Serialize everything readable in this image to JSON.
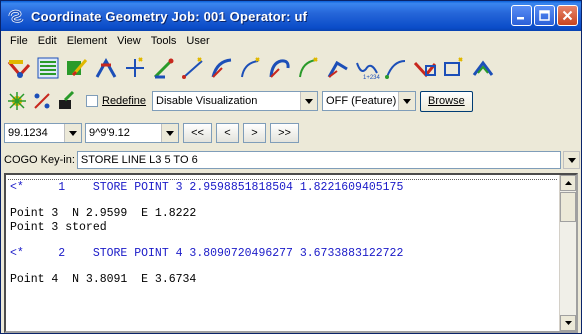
{
  "window": {
    "title": "Coordinate Geometry   Job: 001   Operator: uf"
  },
  "menu": [
    {
      "label": "File",
      "key": "file"
    },
    {
      "label": "Edit",
      "key": "edit"
    },
    {
      "label": "Element",
      "key": "element"
    },
    {
      "label": "View",
      "key": "view"
    },
    {
      "label": "Tools",
      "key": "tools"
    },
    {
      "label": "User",
      "key": "user"
    }
  ],
  "toolbar1": {
    "icons": [
      "store-point-icon",
      "point-list-icon",
      "edit-point-icon",
      "locate-point-icon",
      "add-point-icon",
      "store-line-icon",
      "add-line-icon",
      "store-curve-icon",
      "add-curve-icon",
      "store-spiral-icon",
      "add-spiral-icon",
      "store-chain-icon",
      "store-parcel-icon",
      "add-chain-icon",
      "add-parcel-icon",
      "store-alignment-icon"
    ]
  },
  "toolbar2": {
    "icons": [
      "visualize-icon",
      "percent-icon",
      "redefine-brush-icon"
    ],
    "redefine_label": "Redefine",
    "visualization_value": "Disable Visualization",
    "feature_value": "OFF (Feature)",
    "browse_label": "Browse"
  },
  "toolbar3": {
    "distance_value": "99.1234",
    "angle_value": "9^9'9.12",
    "nav_first": "<<",
    "nav_prev": "<",
    "nav_next": ">",
    "nav_last": ">>"
  },
  "keyin": {
    "label": "COGO Key-in:",
    "value": "STORE LINE L3 5 TO 6"
  },
  "output": {
    "lines": [
      {
        "type": "cmd",
        "text": "<*     1    STORE POINT 3 2.9598851818504 1.8221609405175"
      },
      {
        "type": "blank",
        "text": ""
      },
      {
        "type": "text",
        "text": "Point 3  N 2.9599  E 1.8222"
      },
      {
        "type": "text",
        "text": "Point 3 stored"
      },
      {
        "type": "blank",
        "text": ""
      },
      {
        "type": "cmd",
        "text": "<*     2    STORE POINT 4 3.8090720496277 3.6733883122722"
      },
      {
        "type": "blank",
        "text": ""
      },
      {
        "type": "text",
        "text": "Point 4  N 3.8091  E 3.6734"
      }
    ]
  },
  "colors": {
    "titlebar": "#0a4cc8",
    "command_text": "#1a1ac8",
    "icon_blue": "#1c4fb8",
    "icon_red": "#c8281e",
    "icon_green": "#2a9a2a",
    "icon_yellow": "#e0b800"
  }
}
